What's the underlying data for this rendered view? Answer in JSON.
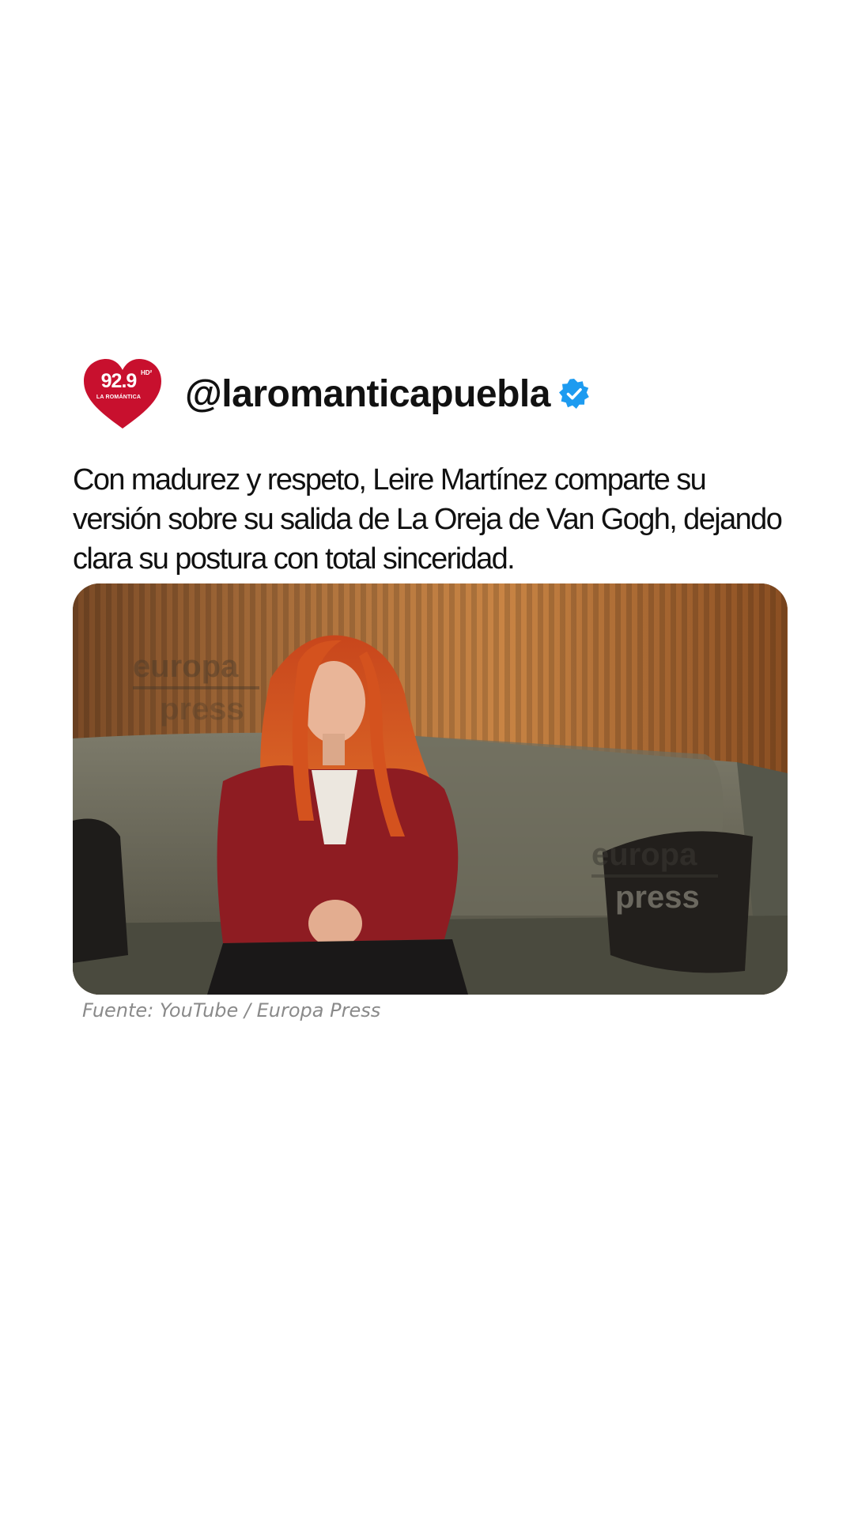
{
  "post": {
    "logo": {
      "frequency": "92.9",
      "hd_mark": "HD²",
      "station_name": "LA ROMÁNTICA",
      "color": "#c8102e"
    },
    "handle": "@laromanticapuebla",
    "verified_icon": "verified-badge-icon",
    "verified_color": "#1d9bf0",
    "caption": "Con madurez y respeto, Leire Martínez comparte su versión sobre su salida de La Oreja de Van Gogh, dejando clara su postura con total sinceridad.",
    "media": {
      "watermarks": [
        "europa",
        "press",
        "europa",
        "press"
      ]
    },
    "source": "Fuente: YouTube / Europa Press"
  }
}
